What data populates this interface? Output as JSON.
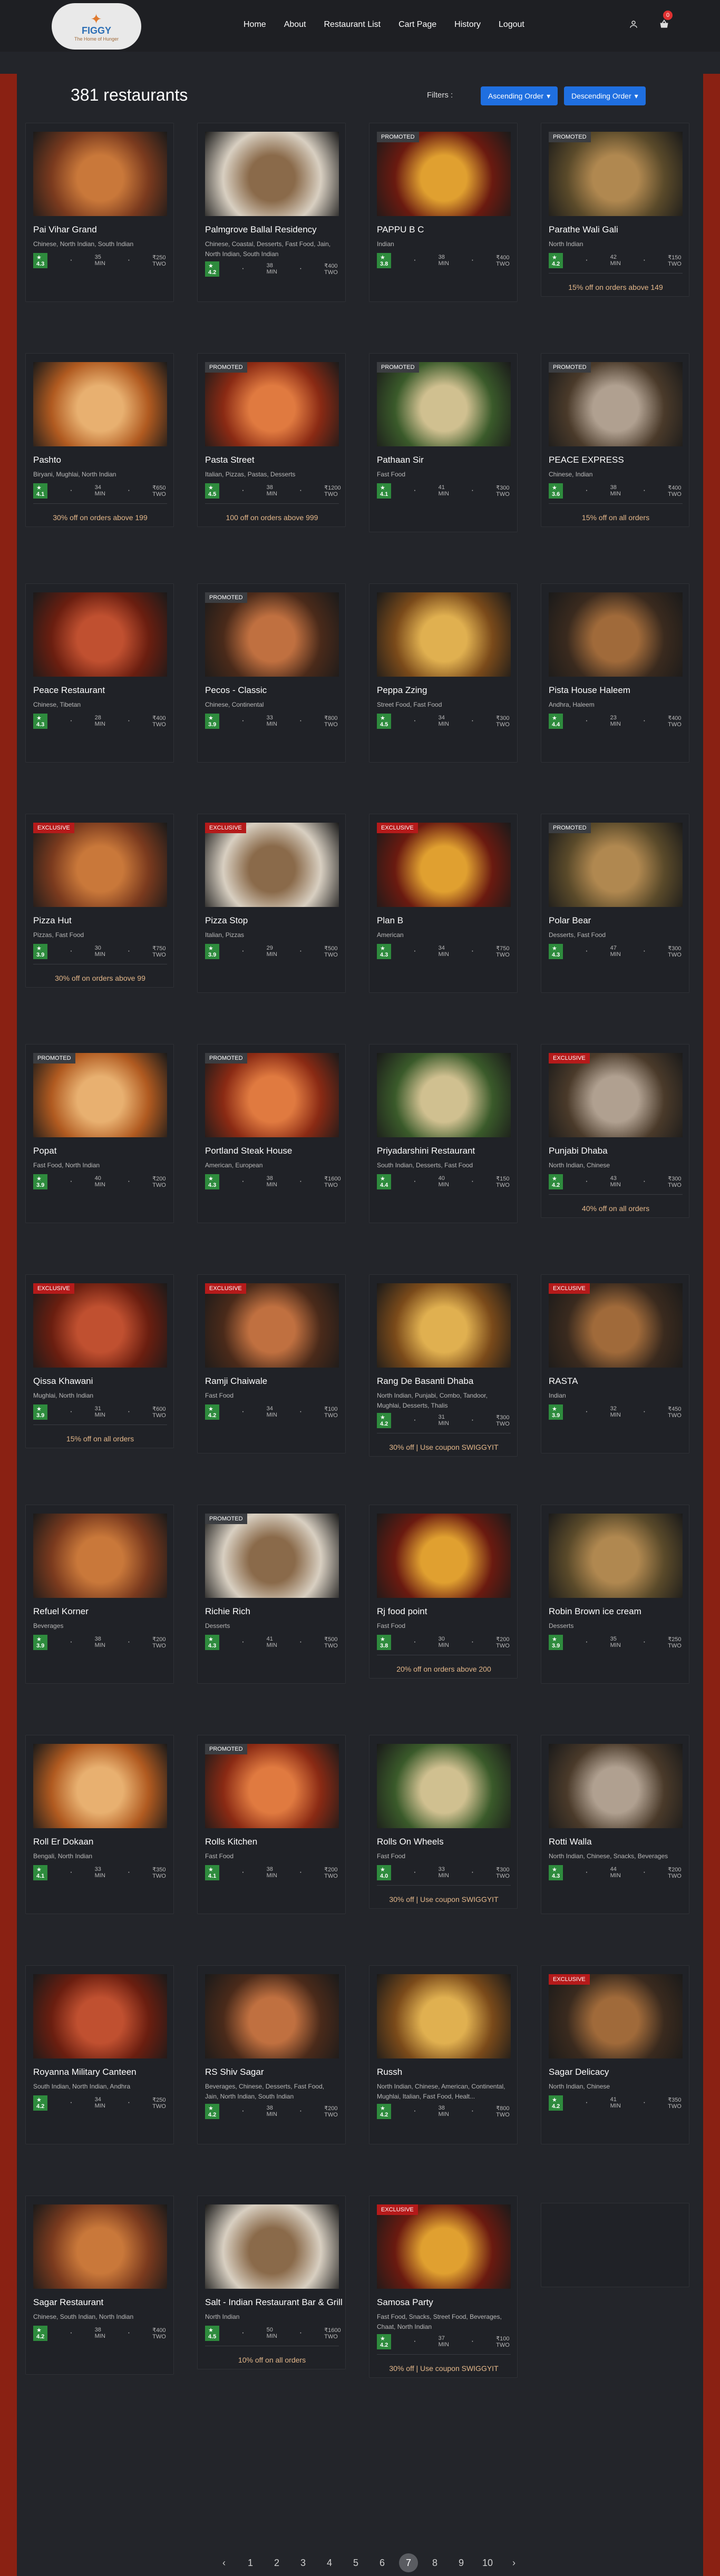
{
  "header": {
    "logo_mark": "FIGGY",
    "logo_tagline": "The Home of Hunger",
    "nav": [
      "Home",
      "About",
      "Restaurant List",
      "Cart Page",
      "History",
      "Logout"
    ],
    "cart_count": "0"
  },
  "listing": {
    "count_label": "381 restaurants",
    "filters_label": "Filters :",
    "sort_asc": "Ascending Order",
    "sort_desc": "Descending Order"
  },
  "restaurants": [
    {
      "name": "Pai Vihar Grand",
      "cuisine": "Chinese, North Indian, South Indian",
      "rating": "4.3",
      "time": "35 MIN",
      "cost": "₹250 TWO",
      "badge": "",
      "offer": ""
    },
    {
      "name": "Palmgrove Ballal Residency",
      "cuisine": "Chinese, Coastal, Desserts, Fast Food, Jain, North Indian, South Indian",
      "rating": "4.2",
      "time": "38 MIN",
      "cost": "₹400 TWO",
      "badge": "",
      "offer": ""
    },
    {
      "name": "PAPPU B C",
      "cuisine": "Indian",
      "rating": "3.8",
      "time": "38 MIN",
      "cost": "₹400 TWO",
      "badge": "PROMOTED",
      "offer": ""
    },
    {
      "name": "Parathe Wali Gali",
      "cuisine": "North Indian",
      "rating": "4.2",
      "time": "42 MIN",
      "cost": "₹150 TWO",
      "badge": "PROMOTED",
      "offer": "15% off on orders above 149"
    },
    {
      "name": "Pashto",
      "cuisine": "Biryani, Mughlai, North Indian",
      "rating": "4.1",
      "time": "34 MIN",
      "cost": "₹650 TWO",
      "badge": "",
      "offer": "30% off on orders above 199"
    },
    {
      "name": "Pasta Street",
      "cuisine": "Italian, Pizzas, Pastas, Desserts",
      "rating": "4.5",
      "time": "38 MIN",
      "cost": "₹1200 TWO",
      "badge": "PROMOTED",
      "offer": "100 off on orders above 999"
    },
    {
      "name": "Pathaan Sir",
      "cuisine": "Fast Food",
      "rating": "4.1",
      "time": "41 MIN",
      "cost": "₹300 TWO",
      "badge": "PROMOTED",
      "offer": ""
    },
    {
      "name": "PEACE EXPRESS",
      "cuisine": "Chinese, Indian",
      "rating": "3.6",
      "time": "38 MIN",
      "cost": "₹400 TWO",
      "badge": "PROMOTED",
      "offer": "15% off on all orders"
    },
    {
      "name": "Peace Restaurant",
      "cuisine": "Chinese, Tibetan",
      "rating": "4.3",
      "time": "28 MIN",
      "cost": "₹400 TWO",
      "badge": "",
      "offer": ""
    },
    {
      "name": "Pecos - Classic",
      "cuisine": "Chinese, Continental",
      "rating": "3.9",
      "time": "33 MIN",
      "cost": "₹800 TWO",
      "badge": "PROMOTED",
      "offer": ""
    },
    {
      "name": "Peppa Zzing",
      "cuisine": "Street Food, Fast Food",
      "rating": "4.5",
      "time": "34 MIN",
      "cost": "₹300 TWO",
      "badge": "",
      "offer": ""
    },
    {
      "name": "Pista House Haleem",
      "cuisine": "Andhra, Haleem",
      "rating": "4.4",
      "time": "23 MIN",
      "cost": "₹400 TWO",
      "badge": "",
      "offer": ""
    },
    {
      "name": "Pizza Hut",
      "cuisine": "Pizzas, Fast Food",
      "rating": "3.9",
      "time": "30 MIN",
      "cost": "₹750 TWO",
      "badge": "EXCLUSIVE",
      "offer": "30% off on orders above 99"
    },
    {
      "name": "Pizza Stop",
      "cuisine": "Italian, Pizzas",
      "rating": "3.9",
      "time": "29 MIN",
      "cost": "₹500 TWO",
      "badge": "EXCLUSIVE",
      "offer": ""
    },
    {
      "name": "Plan B",
      "cuisine": "American",
      "rating": "4.3",
      "time": "34 MIN",
      "cost": "₹750 TWO",
      "badge": "EXCLUSIVE",
      "offer": ""
    },
    {
      "name": "Polar Bear",
      "cuisine": "Desserts, Fast Food",
      "rating": "4.3",
      "time": "47 MIN",
      "cost": "₹300 TWO",
      "badge": "PROMOTED",
      "offer": ""
    },
    {
      "name": "Popat",
      "cuisine": "Fast Food, North Indian",
      "rating": "3.9",
      "time": "40 MIN",
      "cost": "₹200 TWO",
      "badge": "PROMOTED",
      "offer": ""
    },
    {
      "name": "Portland Steak House",
      "cuisine": "American, European",
      "rating": "4.3",
      "time": "38 MIN",
      "cost": "₹1600 TWO",
      "badge": "PROMOTED",
      "offer": ""
    },
    {
      "name": "Priyadarshini Restaurant",
      "cuisine": "South Indian, Desserts, Fast Food",
      "rating": "4.4",
      "time": "40 MIN",
      "cost": "₹150 TWO",
      "badge": "",
      "offer": ""
    },
    {
      "name": "Punjabi Dhaba",
      "cuisine": "North Indian, Chinese",
      "rating": "4.2",
      "time": "43 MIN",
      "cost": "₹300 TWO",
      "badge": "EXCLUSIVE",
      "offer": "40% off on all orders"
    },
    {
      "name": "Qissa Khawani",
      "cuisine": "Mughlai, North Indian",
      "rating": "3.9",
      "time": "31 MIN",
      "cost": "₹600 TWO",
      "badge": "EXCLUSIVE",
      "offer": "15% off on all orders"
    },
    {
      "name": "Ramji Chaiwale",
      "cuisine": "Fast Food",
      "rating": "4.2",
      "time": "34 MIN",
      "cost": "₹100 TWO",
      "badge": "EXCLUSIVE",
      "offer": ""
    },
    {
      "name": "Rang De Basanti Dhaba",
      "cuisine": "North Indian, Punjabi, Combo, Tandoor, Mughlai, Desserts, Thalis",
      "rating": "4.2",
      "time": "31 MIN",
      "cost": "₹300 TWO",
      "badge": "",
      "offer": "30% off | Use coupon SWIGGYIT"
    },
    {
      "name": "RASTA",
      "cuisine": "Indian",
      "rating": "3.9",
      "time": "32 MIN",
      "cost": "₹450 TWO",
      "badge": "EXCLUSIVE",
      "offer": ""
    },
    {
      "name": "Refuel Korner",
      "cuisine": "Beverages",
      "rating": "3.9",
      "time": "38 MIN",
      "cost": "₹200 TWO",
      "badge": "",
      "offer": ""
    },
    {
      "name": "Richie Rich",
      "cuisine": "Desserts",
      "rating": "4.3",
      "time": "41 MIN",
      "cost": "₹500 TWO",
      "badge": "PROMOTED",
      "offer": ""
    },
    {
      "name": "Rj food point",
      "cuisine": "Fast Food",
      "rating": "3.8",
      "time": "30 MIN",
      "cost": "₹200 TWO",
      "badge": "",
      "offer": "20% off on orders above 200"
    },
    {
      "name": "Robin Brown ice cream",
      "cuisine": "Desserts",
      "rating": "3.9",
      "time": "35 MIN",
      "cost": "₹250 TWO",
      "badge": "",
      "offer": ""
    },
    {
      "name": "Roll Er Dokaan",
      "cuisine": "Bengali, North Indian",
      "rating": "4.1",
      "time": "33 MIN",
      "cost": "₹350 TWO",
      "badge": "",
      "offer": ""
    },
    {
      "name": "Rolls Kitchen",
      "cuisine": "Fast Food",
      "rating": "4.1",
      "time": "38 MIN",
      "cost": "₹200 TWO",
      "badge": "PROMOTED",
      "offer": ""
    },
    {
      "name": "Rolls On Wheels",
      "cuisine": "Fast Food",
      "rating": "4.0",
      "time": "33 MIN",
      "cost": "₹300 TWO",
      "badge": "",
      "offer": "30% off | Use coupon SWIGGYIT"
    },
    {
      "name": "Rotti Walla",
      "cuisine": "North Indian, Chinese, Snacks, Beverages",
      "rating": "4.3",
      "time": "44 MIN",
      "cost": "₹200 TWO",
      "badge": "",
      "offer": ""
    },
    {
      "name": "Royanna Military Canteen",
      "cuisine": "South Indian, North Indian, Andhra",
      "rating": "4.2",
      "time": "34 MIN",
      "cost": "₹250 TWO",
      "badge": "",
      "offer": ""
    },
    {
      "name": "RS Shiv Sagar",
      "cuisine": "Beverages, Chinese, Desserts, Fast Food, Jain, North Indian, South Indian",
      "rating": "4.2",
      "time": "38 MIN",
      "cost": "₹200 TWO",
      "badge": "",
      "offer": ""
    },
    {
      "name": "Russh",
      "cuisine": "North Indian, Chinese, American, Continental, Mughlai, Italian, Fast Food, Healt...",
      "rating": "4.2",
      "time": "38 MIN",
      "cost": "₹800 TWO",
      "badge": "",
      "offer": ""
    },
    {
      "name": "Sagar Delicacy",
      "cuisine": "North Indian, Chinese",
      "rating": "4.2",
      "time": "41 MIN",
      "cost": "₹350 TWO",
      "badge": "EXCLUSIVE",
      "offer": ""
    },
    {
      "name": "Sagar Restaurant",
      "cuisine": "Chinese, South Indian, North Indian",
      "rating": "4.2",
      "time": "38 MIN",
      "cost": "₹400 TWO",
      "badge": "",
      "offer": ""
    },
    {
      "name": "Salt - Indian Restaurant Bar & Grill",
      "cuisine": "North Indian",
      "rating": "4.5",
      "time": "50 MIN",
      "cost": "₹1600 TWO",
      "badge": "",
      "offer": "10% off on all orders"
    },
    {
      "name": "Samosa Party",
      "cuisine": "Fast Food, Snacks, Street Food, Beverages, Chaat, North Indian",
      "rating": "4.2",
      "time": "37 MIN",
      "cost": "₹100 TWO",
      "badge": "EXCLUSIVE",
      "offer": "30% off | Use coupon SWIGGYIT"
    }
  ],
  "pagination": {
    "prev": "‹",
    "pages": [
      "1",
      "2",
      "3",
      "4",
      "5",
      "6",
      "7",
      "8",
      "9",
      "10"
    ],
    "active": "7",
    "next": "›"
  }
}
